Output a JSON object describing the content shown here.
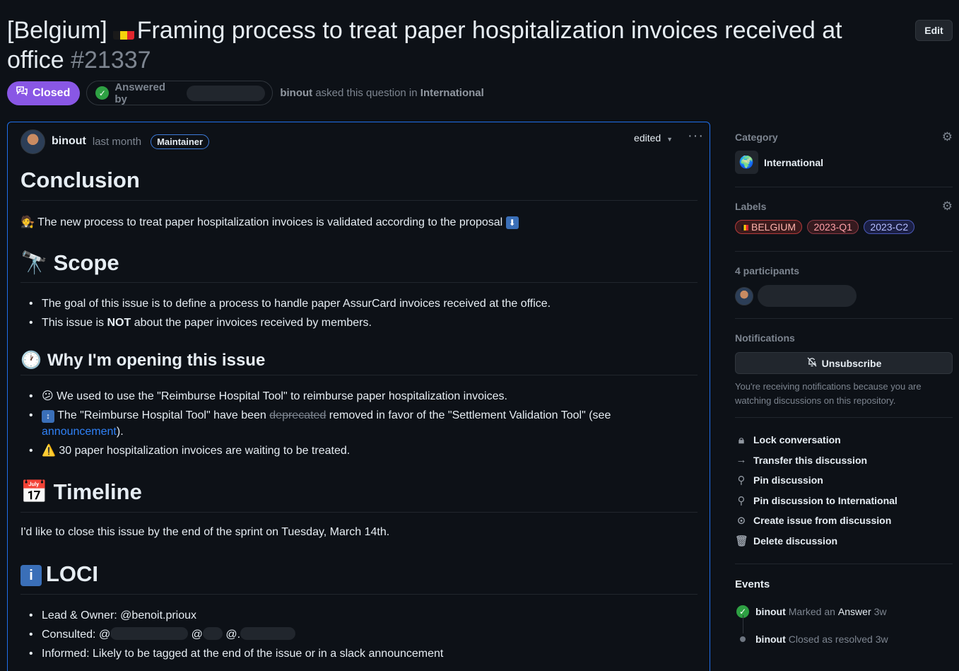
{
  "title": {
    "prefix": "[Belgium]",
    "text": "Framing process to treat paper hospitalization invoices received at office",
    "number": "#21337"
  },
  "header": {
    "edit_label": "Edit"
  },
  "status": {
    "closed_label": "Closed",
    "answered_label": "Answered by",
    "asked_user": "binout",
    "asked_text": "asked this question in",
    "asked_category": "International"
  },
  "comment": {
    "author": "binout",
    "when": "last month",
    "role": "Maintainer",
    "edited": "edited",
    "conclusion_heading": "Conclusion",
    "conclusion_text": "The new process to treat paper hospitalization invoices is validated according to the proposal",
    "scope_heading": "Scope",
    "scope_items": [
      "The goal of this issue is to define a process to handle paper AssurCard invoices received at the office.",
      "This issue is",
      "NOT",
      "about the paper invoices received by members."
    ],
    "why_heading": "Why I'm opening this issue",
    "why_item1": "We used to use the \"Reimburse Hospital Tool\" to reimburse paper hospitalization invoices.",
    "why_item2_a": "The \"Reimburse Hospital Tool\" have been",
    "why_item2_strike": "deprecated",
    "why_item2_b": "removed in favor of the \"Settlement Validation Tool\" (see",
    "why_item2_link": "announcement",
    "why_item2_c": ").",
    "why_item3": "30 paper hospitalization invoices are waiting to be treated.",
    "timeline_heading": "Timeline",
    "timeline_text": "I'd like to close this issue by the end of the sprint on Tuesday, March 14th.",
    "loci_heading": "LOCI",
    "loci_lead": "Lead & Owner: @benoit.prioux",
    "loci_consulted": "Consulted: @",
    "loci_at1": "@",
    "loci_at2": "@.",
    "loci_informed": "Informed: Likely to be tagged at the end of the issue or in a slack announcement"
  },
  "sidebar": {
    "category_label": "Category",
    "category_value": "International",
    "labels_label": "Labels",
    "labels": [
      "BELGIUM",
      "2023-Q1",
      "2023-C2"
    ],
    "participants_label": "4 participants",
    "notifications_label": "Notifications",
    "unsubscribe_label": "Unsubscribe",
    "notice": "You're receiving notifications because you are watching discussions on this repository.",
    "actions": [
      "Lock conversation",
      "Transfer this discussion",
      "Pin discussion",
      "Pin discussion to International",
      "Create issue from discussion",
      "Delete discussion"
    ],
    "events_label": "Events",
    "events": [
      {
        "user": "binout",
        "a": "Marked an",
        "b": "Answer",
        "time": "3w"
      },
      {
        "user": "binout",
        "a": "Closed as resolved",
        "time": "3w"
      }
    ]
  },
  "colors": {
    "accent_purple": "#8957e5",
    "link_blue": "#2f81f7",
    "success": "#2ea043",
    "bg": "#0d1117"
  }
}
